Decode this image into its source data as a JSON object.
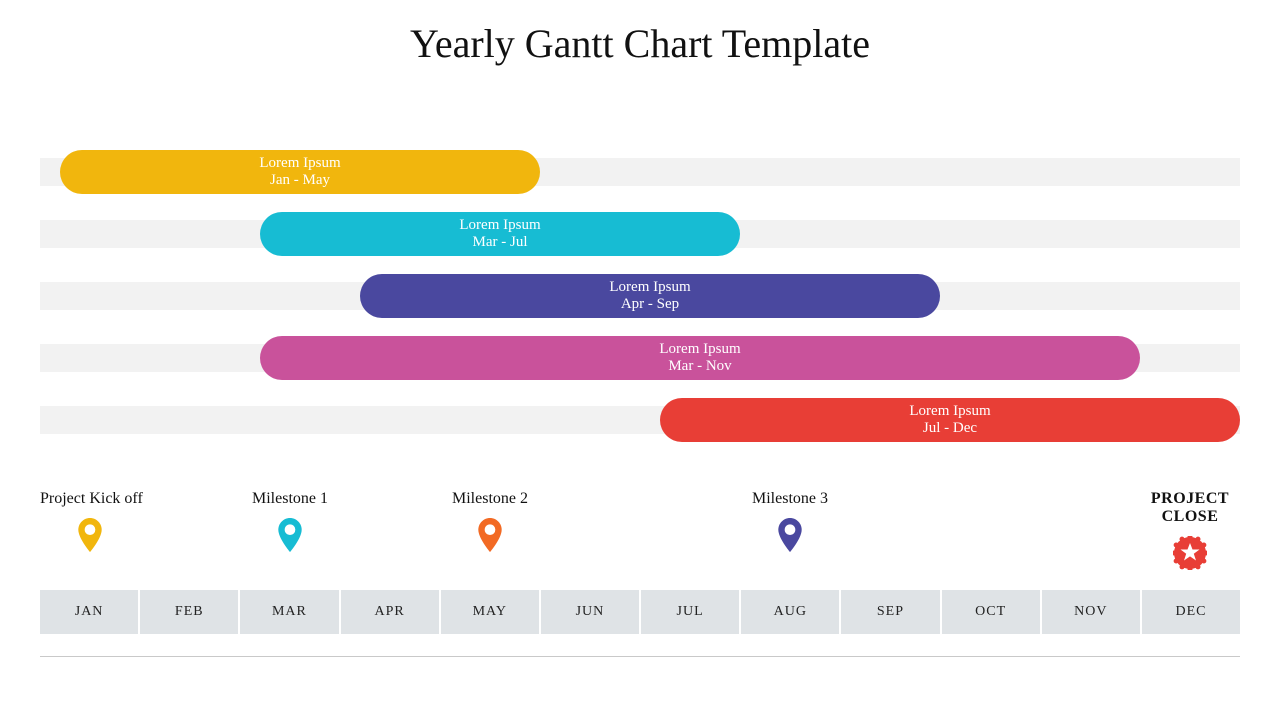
{
  "title": "Yearly Gantt Chart Template",
  "chart_data": {
    "type": "bar",
    "title": "Yearly Gantt Chart Template",
    "xlabel": "",
    "categories": [
      "JAN",
      "FEB",
      "MAR",
      "APR",
      "MAY",
      "JUN",
      "JUL",
      "AUG",
      "SEP",
      "OCT",
      "NOV",
      "DEC"
    ],
    "series": [
      {
        "name": "Lorem Ipsum",
        "range_label": "Jan - May",
        "start_month": 1,
        "end_month": 5,
        "color": "#f1b60d"
      },
      {
        "name": "Lorem Ipsum",
        "range_label": "Mar - Jul",
        "start_month": 3,
        "end_month": 7,
        "color": "#17bcd3"
      },
      {
        "name": "Lorem Ipsum",
        "range_label": "Apr - Sep",
        "start_month": 4,
        "end_month": 9,
        "color": "#4a489f"
      },
      {
        "name": "Lorem Ipsum",
        "range_label": "Mar - Nov",
        "start_month": 3,
        "end_month": 11,
        "color": "#c9529b"
      },
      {
        "name": "Lorem Ipsum",
        "range_label": "Jul - Dec",
        "start_month": 7,
        "end_month": 12,
        "color": "#e83e36"
      }
    ],
    "milestones": [
      {
        "label": "Project Kick off",
        "month": 1,
        "color": "#f1b60d",
        "icon": "pin"
      },
      {
        "label": "Milestone 1",
        "month": 3,
        "color": "#17bcd3",
        "icon": "pin"
      },
      {
        "label": "Milestone 2",
        "month": 5,
        "color": "#f26a24",
        "icon": "pin"
      },
      {
        "label": "Milestone 3",
        "month": 8,
        "color": "#4a489f",
        "icon": "pin"
      },
      {
        "label": "PROJECT CLOSE",
        "month": 12,
        "color": "#e83e36",
        "icon": "star",
        "bold": true
      }
    ]
  }
}
